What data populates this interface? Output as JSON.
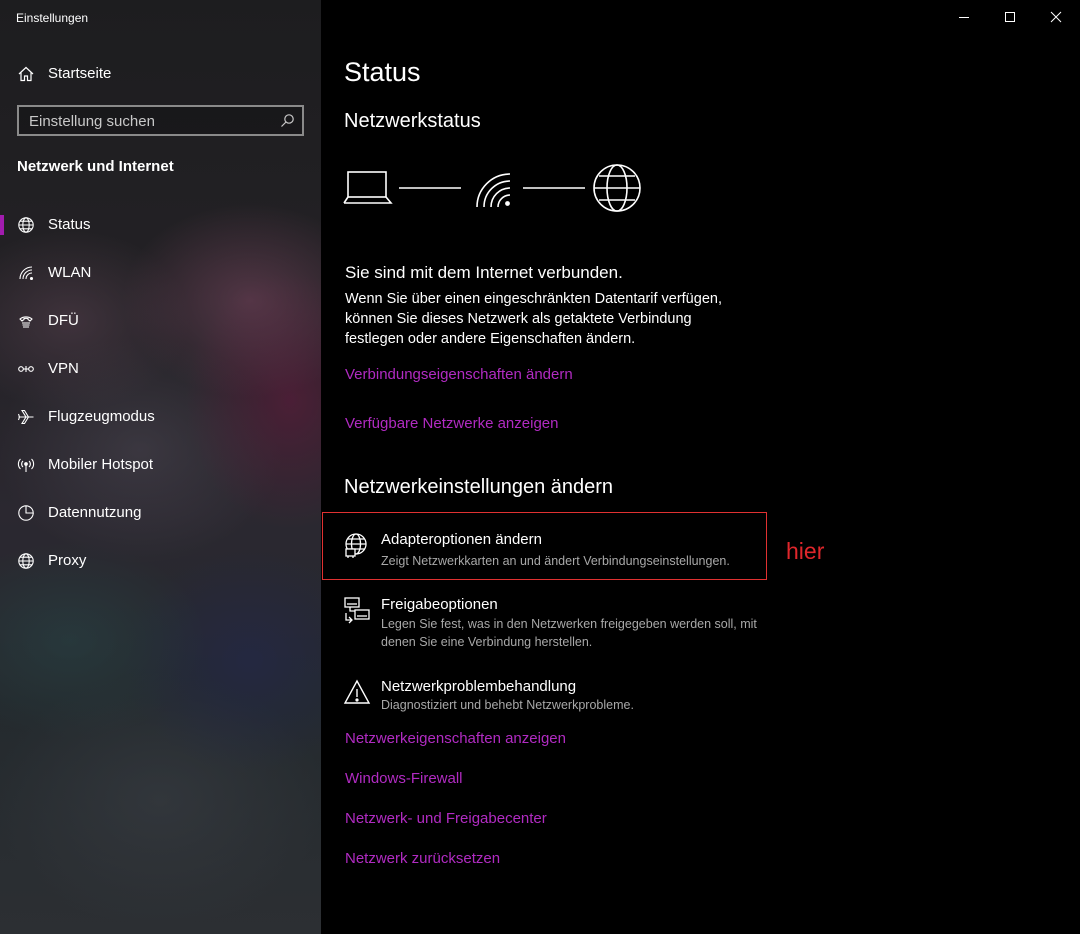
{
  "window": {
    "title": "Einstellungen",
    "controls": [
      "minimize",
      "maximize",
      "close"
    ]
  },
  "sidebar": {
    "home_label": "Startseite",
    "search": {
      "placeholder": "Einstellung suchen"
    },
    "section_heading": "Netzwerk und Internet",
    "items": [
      {
        "label": "Status",
        "icon": "globe-icon",
        "selected": true
      },
      {
        "label": "WLAN",
        "icon": "wifi-icon",
        "selected": false
      },
      {
        "label": "DFÜ",
        "icon": "dialup-icon",
        "selected": false
      },
      {
        "label": "VPN",
        "icon": "vpn-icon",
        "selected": false
      },
      {
        "label": "Flugzeugmodus",
        "icon": "airplane-icon",
        "selected": false
      },
      {
        "label": "Mobiler Hotspot",
        "icon": "hotspot-icon",
        "selected": false
      },
      {
        "label": "Datennutzung",
        "icon": "data-usage-icon",
        "selected": false
      },
      {
        "label": "Proxy",
        "icon": "globe-icon",
        "selected": false
      }
    ]
  },
  "main": {
    "title": "Status",
    "network_status_heading": "Netzwerkstatus",
    "status_headline": "Sie sind mit dem Internet verbunden.",
    "status_description": "Wenn Sie über einen eingeschränkten Datentarif verfügen, können Sie dieses Netzwerk als getaktete Verbindung festlegen oder andere Eigenschaften ändern.",
    "links_top": {
      "connection_properties": "Verbindungseigenschaften ändern",
      "available_networks": "Verfügbare Netzwerke anzeigen"
    },
    "change_settings_heading": "Netzwerkeinstellungen ändern",
    "settings": [
      {
        "title": "Adapteroptionen ändern",
        "description": "Zeigt Netzwerkkarten an und ändert Verbindungseinstellungen.",
        "icon": "adapter-icon"
      },
      {
        "title": "Freigabeoptionen",
        "description": "Legen Sie fest, was in den Netzwerken freigegeben werden soll, mit denen Sie eine Verbindung herstellen.",
        "icon": "sharing-icon"
      },
      {
        "title": "Netzwerkproblembehandlung",
        "description": "Diagnostiziert und behebt Netzwerkprobleme.",
        "icon": "warning-icon"
      }
    ],
    "links_bottom": {
      "network_properties": "Netzwerkeigenschaften anzeigen",
      "firewall": "Windows-Firewall",
      "sharing_center": "Netzwerk- und Freigabecenter",
      "reset": "Netzwerk zurücksetzen"
    },
    "annotation": "hier"
  },
  "colors": {
    "accent": "#a21caf",
    "link": "#b12bc2",
    "annotation": "#e0262b",
    "background": "#000000"
  }
}
